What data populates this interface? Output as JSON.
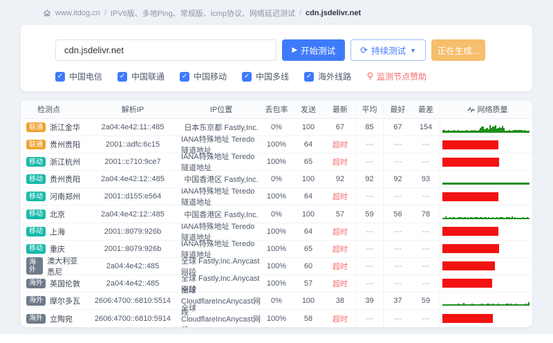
{
  "breadcrumb": {
    "site": "www.itdog.cn",
    "separator": "/",
    "path": "IPV6版、多地Ping、常规版、icmp协议、网络延迟测试",
    "target": "cdn.jsdelivr.net"
  },
  "test_panel": {
    "input_value": "cdn.jsdelivr.net",
    "start_button": "开始测试",
    "continuous_button": "持续测试",
    "generating_button": "正在生成...",
    "checkboxes": [
      {
        "label": "中国电信",
        "checked": true
      },
      {
        "label": "中国联通",
        "checked": true
      },
      {
        "label": "中国移动",
        "checked": true
      },
      {
        "label": "中国多线",
        "checked": true
      },
      {
        "label": "海外线路",
        "checked": true
      }
    ],
    "sponsor_link": "监测节点赞助"
  },
  "table": {
    "headers": [
      "检测点",
      "解析IP",
      "IP位置",
      "丢包率",
      "发送",
      "最新",
      "平均",
      "最好",
      "最差",
      "网络质量"
    ],
    "timeout_label": "超时",
    "empty_value": "---",
    "rows": [
      {
        "line": "联通",
        "line_type": "unicom",
        "node": "浙江金华",
        "ip": "2a04:4e42:11::485",
        "ip_location": "日本东京都 Fastly,Inc.",
        "loss": "0%",
        "sent": 100,
        "latest": "67",
        "avg": "85",
        "best": "67",
        "worst": "154",
        "quality": {
          "style": "spark",
          "profile": "spiky",
          "pct": 100
        }
      },
      {
        "line": "联通",
        "line_type": "unicom",
        "node": "贵州贵阳",
        "ip": "2001::adfc:6c15",
        "ip_location": "IANA特殊地址 Teredo隧道地址",
        "loss": "100%",
        "sent": 64,
        "latest": "超时",
        "avg": "---",
        "best": "---",
        "worst": "---",
        "quality": {
          "style": "bar",
          "pct": 64
        }
      },
      {
        "line": "移动",
        "line_type": "mobile",
        "node": "浙江杭州",
        "ip": "2001::c710:9ce7",
        "ip_location": "IANA特殊地址 Teredo隧道地址",
        "loss": "100%",
        "sent": 65,
        "latest": "超时",
        "avg": "---",
        "best": "---",
        "worst": "---",
        "quality": {
          "style": "bar",
          "pct": 65
        }
      },
      {
        "line": "移动",
        "line_type": "mobile",
        "node": "贵州贵阳",
        "ip": "2a04:4e42:12::485",
        "ip_location": "中国香港区 Fastly,Inc.",
        "loss": "0%",
        "sent": 100,
        "latest": "92",
        "avg": "92",
        "best": "92",
        "worst": "93",
        "quality": {
          "style": "spark",
          "profile": "flat",
          "pct": 100
        }
      },
      {
        "line": "移动",
        "line_type": "mobile",
        "node": "河南郑州",
        "ip": "2001::d155:e564",
        "ip_location": "IANA特殊地址 Teredo隧道地址",
        "loss": "100%",
        "sent": 64,
        "latest": "超时",
        "avg": "---",
        "best": "---",
        "worst": "---",
        "quality": {
          "style": "bar",
          "pct": 64
        }
      },
      {
        "line": "移动",
        "line_type": "mobile",
        "node": "北京",
        "ip": "2a04:4e42:12::485",
        "ip_location": "中国香港区 Fastly,Inc.",
        "loss": "0%",
        "sent": 100,
        "latest": "57",
        "avg": "59",
        "best": "56",
        "worst": "78",
        "quality": {
          "style": "spark",
          "profile": "jitter",
          "pct": 100
        }
      },
      {
        "line": "移动",
        "line_type": "mobile",
        "node": "上海",
        "ip": "2001::8079:926b",
        "ip_location": "IANA特殊地址 Teredo隧道地址",
        "loss": "100%",
        "sent": 64,
        "latest": "超时",
        "avg": "---",
        "best": "---",
        "worst": "---",
        "quality": {
          "style": "bar",
          "pct": 64
        }
      },
      {
        "line": "移动",
        "line_type": "mobile",
        "node": "重庆",
        "ip": "2001::8079:926b",
        "ip_location": "IANA特殊地址 Teredo隧道地址",
        "loss": "100%",
        "sent": 65,
        "latest": "超时",
        "avg": "---",
        "best": "---",
        "worst": "---",
        "quality": {
          "style": "bar",
          "pct": 65
        }
      },
      {
        "line": "海外",
        "line_type": "overseas",
        "node": "澳大利亚悉尼",
        "ip": "2a04:4e42::485",
        "ip_location": "全球 Fastly,Inc.Anycast网段",
        "loss": "100%",
        "sent": 60,
        "latest": "超时",
        "avg": "---",
        "best": "---",
        "worst": "---",
        "quality": {
          "style": "bar",
          "pct": 60
        }
      },
      {
        "line": "海外",
        "line_type": "overseas",
        "node": "英国伦敦",
        "ip": "2a04:4e42::485",
        "ip_location": "全球 Fastly,Inc.Anycast网段",
        "loss": "100%",
        "sent": 57,
        "latest": "超时",
        "avg": "---",
        "best": "---",
        "worst": "---",
        "quality": {
          "style": "bar",
          "pct": 57
        }
      },
      {
        "line": "海外",
        "line_type": "overseas",
        "node": "摩尔多瓦",
        "ip": "2606:4700::6810:5514",
        "ip_location": "全球 CloudflareIncAnycast网段",
        "loss": "0%",
        "sent": 100,
        "latest": "38",
        "avg": "39",
        "best": "37",
        "worst": "59",
        "quality": {
          "style": "spark",
          "profile": "jitter",
          "pct": 100
        }
      },
      {
        "line": "海外",
        "line_type": "overseas",
        "node": "立陶宛",
        "ip": "2606:4700::6810:5914",
        "ip_location": "全球 CloudflareIncAnycast网段",
        "loss": "100%",
        "sent": 58,
        "latest": "超时",
        "avg": "---",
        "best": "---",
        "worst": "---",
        "quality": {
          "style": "bar",
          "pct": 58
        }
      }
    ]
  },
  "colors": {
    "accent_blue": "#3e7bfa",
    "warning_orange": "#f6be6d",
    "badge_unicom": "#f0a22e",
    "badge_mobile": "#19b9a9",
    "badge_overseas": "#6e7b8a",
    "timeout_red": "#f56c6c",
    "quality_green": "#1f8f1a",
    "quality_red": "#f21212",
    "page_background": "#eef1f5"
  }
}
